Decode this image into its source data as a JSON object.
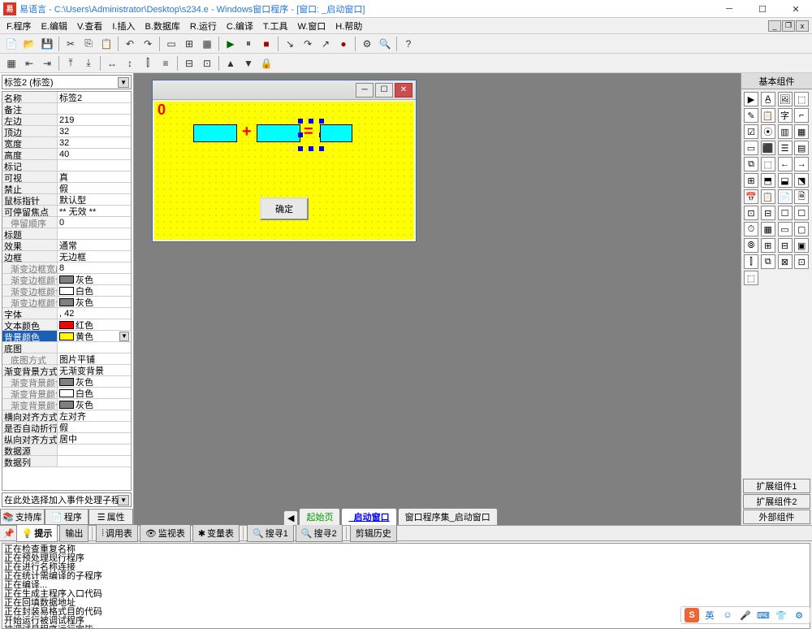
{
  "title": "易语言 - C:\\Users\\Administrator\\Desktop\\s234.e - Windows窗口程序 - [窗口: _启动窗口]",
  "menu": [
    "F.程序",
    "E.编辑",
    "V.查看",
    "I.插入",
    "B.数据库",
    "R.运行",
    "C.编译",
    "T.工具",
    "W.窗口",
    "H.帮助"
  ],
  "prop_combo": "标签2 (标签)",
  "props": [
    {
      "n": "名称",
      "v": "标签2"
    },
    {
      "n": "备注",
      "v": ""
    },
    {
      "n": "左边",
      "v": "219"
    },
    {
      "n": "顶边",
      "v": "32"
    },
    {
      "n": "宽度",
      "v": "32"
    },
    {
      "n": "高度",
      "v": "40"
    },
    {
      "n": "标记",
      "v": ""
    },
    {
      "n": "可视",
      "v": "真"
    },
    {
      "n": "禁止",
      "v": "假"
    },
    {
      "n": "鼠标指针",
      "v": "默认型"
    },
    {
      "n": "可停留焦点",
      "v": "** 无效 **"
    },
    {
      "n": "停留顺序",
      "v": "0",
      "indent": true
    },
    {
      "n": "标题",
      "v": ""
    },
    {
      "n": "效果",
      "v": "通常"
    },
    {
      "n": "边框",
      "v": "无边框"
    },
    {
      "n": "渐变边框宽度",
      "v": "8",
      "indent": true
    },
    {
      "n": "渐变边框颜色1",
      "v": "灰色",
      "c": "#808080",
      "indent": true
    },
    {
      "n": "渐变边框颜色2",
      "v": "白色",
      "c": "#ffffff",
      "indent": true
    },
    {
      "n": "渐变边框颜色3",
      "v": "灰色",
      "c": "#808080",
      "indent": true
    },
    {
      "n": "字体",
      "v": ", 42"
    },
    {
      "n": "文本颜色",
      "v": "红色",
      "c": "#ff0000"
    },
    {
      "n": "背景颜色",
      "v": "黄色",
      "c": "#ffff00",
      "sel": true,
      "dd": true
    },
    {
      "n": "底图",
      "v": ""
    },
    {
      "n": "底图方式",
      "v": "图片平铺",
      "indent": true
    },
    {
      "n": "渐变背景方式",
      "v": "无渐变背景"
    },
    {
      "n": "渐变背景颜色1",
      "v": "灰色",
      "c": "#808080",
      "indent": true
    },
    {
      "n": "渐变背景颜色2",
      "v": "白色",
      "c": "#ffffff",
      "indent": true
    },
    {
      "n": "渐变背景颜色3",
      "v": "灰色",
      "c": "#808080",
      "indent": true
    },
    {
      "n": "横向对齐方式",
      "v": "左对齐"
    },
    {
      "n": "是否自动折行",
      "v": "假"
    },
    {
      "n": "纵向对齐方式",
      "v": "居中"
    },
    {
      "n": "数据源",
      "v": ""
    },
    {
      "n": "数据列",
      "v": ""
    }
  ],
  "event_combo": "在此处选择加入事件处理子程序",
  "prop_tabs": [
    "支持库",
    "程序",
    "属性"
  ],
  "pal_title": "基本组件",
  "pal_expand": [
    "扩展组件1",
    "扩展组件2",
    "外部组件"
  ],
  "doc_tabs": [
    {
      "label": "起始页",
      "cls": "green"
    },
    {
      "label": "_启动窗口",
      "cls": "active"
    },
    {
      "label": "窗口程序集_启动窗口",
      "cls": ""
    }
  ],
  "out_tabs": [
    "提示",
    "输出",
    "调用表",
    "监视表",
    "变量表",
    "搜寻1",
    "搜寻2",
    "剪辑历史"
  ],
  "output_lines": [
    "正在检查重复名称",
    "正在预处理现行程序",
    "正在进行名称连接",
    "正在统计需编译的子程序",
    "正在编译...",
    "正在生成主程序入口代码",
    "正在回填数据地址",
    "正在封装易格式目的代码",
    "开始运行被调试程序",
    "被调试易程序运行完毕"
  ],
  "design": {
    "label0": "0",
    "plus": "+",
    "eq": "=",
    "ok_label": "确定"
  },
  "ime": {
    "brand": "S",
    "lang": "英"
  }
}
